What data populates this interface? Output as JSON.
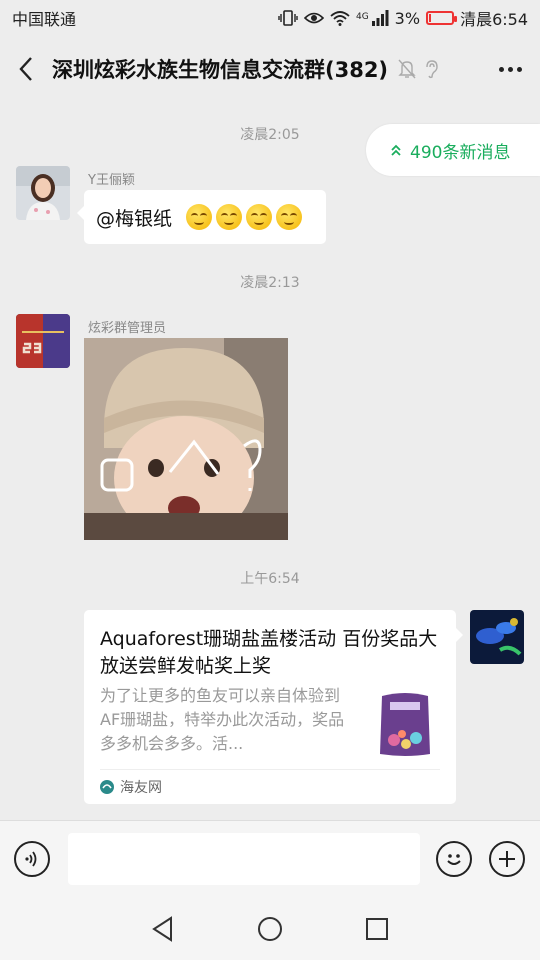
{
  "status_bar": {
    "carrier": "中国联通",
    "network": "4G",
    "battery_percent": "3%",
    "battery_level": 0.03,
    "time": "清晨6:54"
  },
  "header": {
    "title": "深圳炫彩水族生物信息交流群(382)",
    "icons": [
      "back-icon",
      "mute-bell-icon",
      "earpiece-icon",
      "more-icon"
    ]
  },
  "new_messages_label": "490条新消息",
  "messages": [
    {
      "time": "凌晨2:05",
      "sender": "Y王俪颖",
      "text": "@梅银纸",
      "emoji_count": 4
    },
    {
      "time": "凌晨2:13",
      "sender": "炫彩群管理员",
      "type": "sticker"
    },
    {
      "time": "上午6:54",
      "type": "link_card",
      "card": {
        "title": "Aquaforest珊瑚盐盖楼活动 百份奖品大放送尝鲜发帖奖上奖",
        "description": "为了让更多的鱼友可以亲自体验到AF珊瑚盐，特举办此次活动，奖品多多机会多多。活...",
        "source": "海友网"
      }
    }
  ],
  "input": {
    "value": "",
    "placeholder": ""
  },
  "colors": {
    "accent": "#1aad5d",
    "background": "#ededed",
    "battery": "#ee3333"
  }
}
